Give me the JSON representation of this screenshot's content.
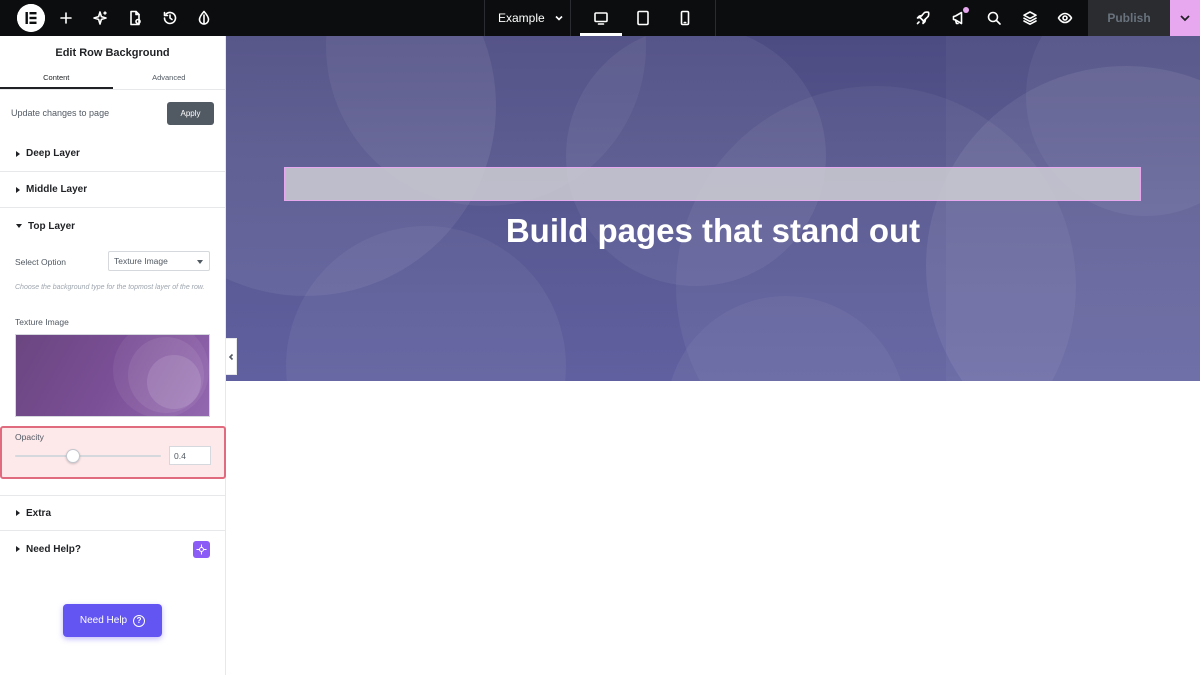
{
  "topbar": {
    "document_title": "Example",
    "publish_label": "Publish",
    "icons": [
      "elementor-logo-icon",
      "add-icon",
      "ai-sparkle-icon",
      "page-settings-icon",
      "history-icon",
      "site-settings-icon",
      "desktop-icon",
      "tablet-icon",
      "mobile-icon",
      "rocket-icon",
      "announcement-icon",
      "search-icon",
      "layers-icon",
      "preview-eye-icon",
      "chevron-down-icon"
    ]
  },
  "panel": {
    "title": "Edit Row Background",
    "tabs": [
      {
        "label": "Content",
        "active": true
      },
      {
        "label": "Advanced",
        "active": false
      }
    ],
    "update_label": "Update changes to page",
    "apply_label": "Apply",
    "sections": {
      "deep": "Deep Layer",
      "middle": "Middle Layer",
      "top": "Top Layer",
      "extra": "Extra",
      "help": "Need Help?"
    },
    "select_option_label": "Select Option",
    "select_option_value": "Texture Image",
    "help_text": "Choose the background type for the topmost layer of the row.",
    "texture_label": "Texture Image",
    "opacity_label": "Opacity",
    "opacity_value": "0.4",
    "opacity_slider_fraction": 0.4
  },
  "floating_help": {
    "label": "Need Help",
    "icon": "question-circle-icon"
  },
  "canvas": {
    "heading": "Build pages that stand out"
  },
  "colors": {
    "topbar_bg": "#0c0d0e",
    "publish_more": "#e8a8f0",
    "highlight_border": "#e06b7f",
    "highlight_bg": "#fde8ea",
    "help_button": "#6355f2",
    "hero_bg": "#56568e"
  }
}
